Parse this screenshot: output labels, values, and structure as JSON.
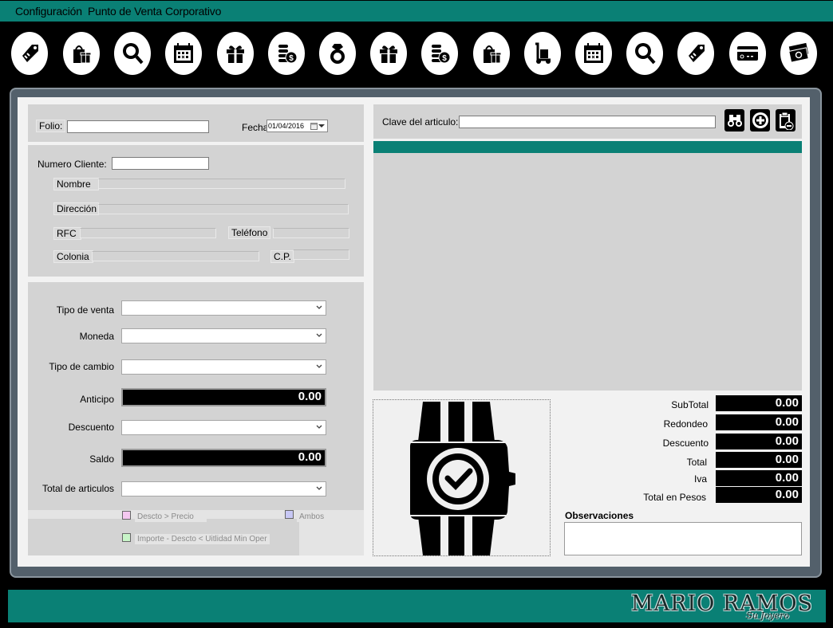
{
  "menu": {
    "items": [
      {
        "label": "Configuración"
      },
      {
        "label": "Punto de Venta"
      },
      {
        "label": "Corporativo"
      }
    ]
  },
  "toolbar": {
    "icons": [
      "price-tag-icon",
      "gift-bag-icon",
      "search-icon",
      "calendar-icon",
      "gift-icon",
      "coins-icon",
      "ring-icon",
      "gift-icon",
      "coins-icon",
      "gift-bag-icon",
      "hand-truck-icon",
      "calendar-icon",
      "search-icon",
      "price-tag-icon",
      "credit-card-icon",
      "cash-icon"
    ]
  },
  "header": {
    "folio_label": "Folio:",
    "folio_value": "",
    "fecha_label": "Fecha",
    "fecha_value": "01/04/2016"
  },
  "client": {
    "numero_label": "Numero Cliente:",
    "numero_value": "",
    "nombre_label": "Nombre",
    "direccion_label": "Dirección",
    "rfc_label": "RFC",
    "telefono_label": "Teléfono",
    "colonia_label": "Colonia",
    "cp_label": "C.P."
  },
  "sale": {
    "tipo_venta_label": "Tipo de venta",
    "moneda_label": "Moneda",
    "tipo_cambio_label": "Tipo de cambio",
    "anticipo_label": "Anticipo",
    "anticipo_value": "0.00",
    "descuento_label": "Descuento",
    "saldo_label": "Saldo",
    "saldo_value": "0.00",
    "total_articulos_label": "Total de articulos"
  },
  "legend": {
    "desc_precio": "Descto > Precio",
    "ambos": "Ambos",
    "importe": "Importe - Descto < Uitlidad Min Oper",
    "colors": {
      "desc_precio": "#f5c8f0",
      "ambos": "#c8c8f5",
      "importe": "#c8f5c8"
    }
  },
  "article": {
    "clave_label": "Clave del articulo:",
    "clave_value": ""
  },
  "totals": {
    "subtotal_label": "SubTotal",
    "subtotal_value": "0.00",
    "redondeo_label": "Redondeo",
    "redondeo_value": "0.00",
    "descuento_label": "Descuento",
    "descuento_value": "0.00",
    "total_label": "Total",
    "total_value": "0.00",
    "iva_label": "Iva",
    "iva_value": "0.00",
    "pesos_label": "Total en Pesos",
    "pesos_value": "0.00"
  },
  "observaciones_label": "Observaciones",
  "brand": {
    "name": "MARIO RAMOS",
    "tagline": "Su Joyero"
  },
  "colors": {
    "accent": "#0a8075",
    "panel": "#d3d3d3"
  }
}
